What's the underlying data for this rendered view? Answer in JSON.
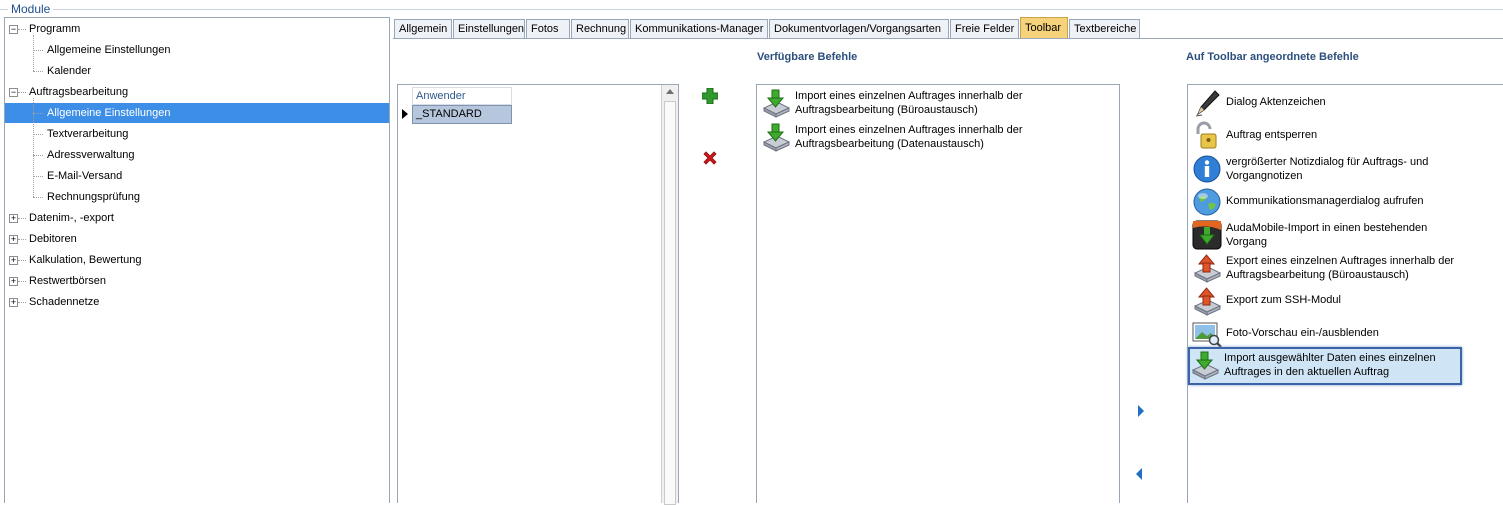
{
  "group_title": "Module",
  "tree": {
    "items": [
      {
        "label": "Programm",
        "level": 0,
        "expanded": true
      },
      {
        "label": "Allgemeine Einstellungen",
        "level": 1
      },
      {
        "label": "Kalender",
        "level": 1
      },
      {
        "label": "Auftragsbearbeitung",
        "level": 0,
        "expanded": true
      },
      {
        "label": "Allgemeine Einstellungen",
        "level": 1,
        "selected": true
      },
      {
        "label": "Textverarbeitung",
        "level": 1
      },
      {
        "label": "Adressverwaltung",
        "level": 1
      },
      {
        "label": "E-Mail-Versand",
        "level": 1
      },
      {
        "label": "Rechnungsprüfung",
        "level": 1
      },
      {
        "label": "Datenim-, -export",
        "level": 0,
        "expanded": false
      },
      {
        "label": "Debitoren",
        "level": 0,
        "expanded": false
      },
      {
        "label": "Kalkulation, Bewertung",
        "level": 0,
        "expanded": false
      },
      {
        "label": "Restwertbörsen",
        "level": 0,
        "expanded": false
      },
      {
        "label": "Schadennetze",
        "level": 0,
        "expanded": false
      }
    ]
  },
  "tabs": [
    {
      "label": "Allgemein"
    },
    {
      "label": "Einstellungen"
    },
    {
      "label": "Fotos"
    },
    {
      "label": "Rechnung"
    },
    {
      "label": "Kommunikations-Manager"
    },
    {
      "label": "Dokumentvorlagen/Vorgangsarten"
    },
    {
      "label": "Freie Felder"
    },
    {
      "label": "Toolbar",
      "active": true
    },
    {
      "label": "Textbereiche"
    }
  ],
  "users": {
    "header": "Anwender",
    "rows": [
      "_STANDARD"
    ]
  },
  "available": {
    "title": "Verfügbare Befehle",
    "items": [
      {
        "text": "Import eines einzelnen Auftrages innerhalb der\nAuftragsbearbeitung (Büroaustausch)",
        "icon": "import-icon"
      },
      {
        "text": "Import eines einzelnen Auftrages innerhalb der\nAuftragsbearbeitung (Datenaustausch)",
        "icon": "import-icon"
      }
    ]
  },
  "toolbar": {
    "title": "Auf Toolbar angeordnete Befehle",
    "items": [
      {
        "text": "Dialog Aktenzeichen",
        "icon": "pen-icon"
      },
      {
        "text": "Auftrag entsperren",
        "icon": "unlock-icon"
      },
      {
        "text": "vergrößerter Notizdialog für Auftrags- und\nVorgangnotizen",
        "icon": "info-icon"
      },
      {
        "text": "Kommunikationsmanagerdialog aufrufen",
        "icon": "globe-icon"
      },
      {
        "text": "AudaMobile-Import in einen bestehenden\nVorgang",
        "icon": "audamobile-icon"
      },
      {
        "text": "Export eines einzelnen Auftrages innerhalb der\nAuftragsbearbeitung (Büroaustausch)",
        "icon": "export-icon"
      },
      {
        "text": "Export zum SSH-Modul",
        "icon": "export-icon"
      },
      {
        "text": "Foto-Vorschau ein-/ausblenden",
        "icon": "photo-preview-icon"
      },
      {
        "text": "Import ausgewählter Daten eines einzelnen\nAuftrages in den aktuellen Auftrag",
        "icon": "import-icon",
        "selected": true
      }
    ]
  },
  "colors": {
    "accent": "#3d8ee6",
    "active_tab": "#f6d27a",
    "header_text": "#2c4f7c",
    "add": "#2e9a2e",
    "remove": "#d01818"
  }
}
